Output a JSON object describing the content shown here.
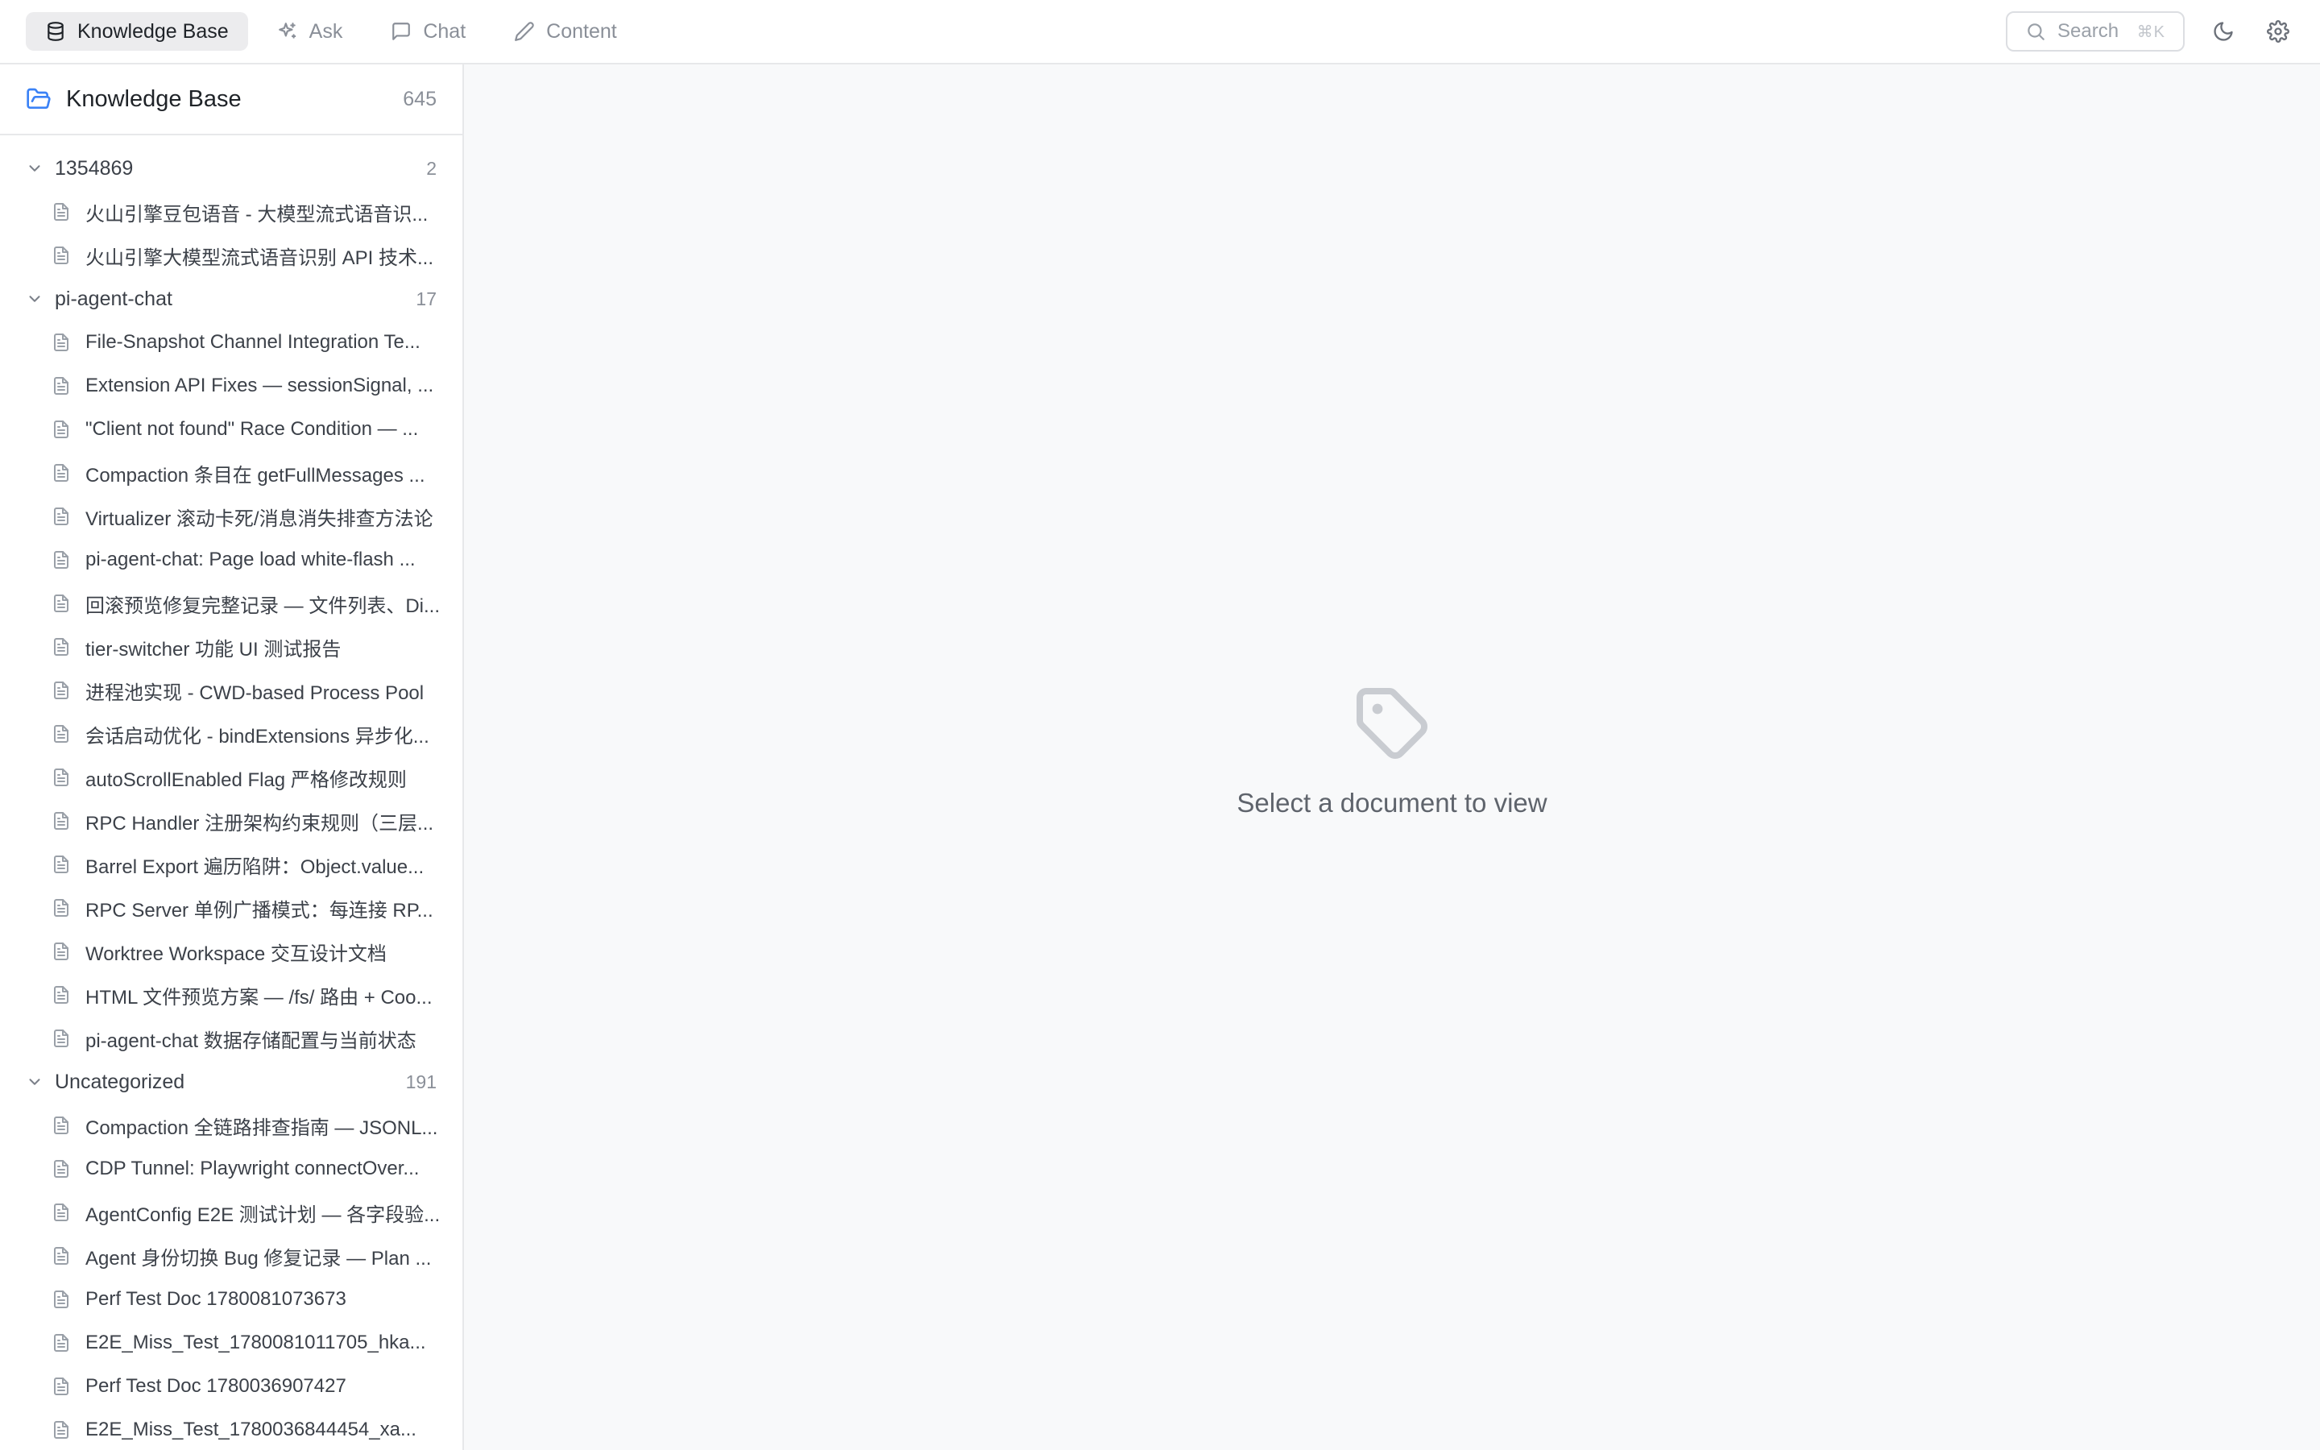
{
  "topbar": {
    "tabs": [
      {
        "label": "Knowledge Base",
        "icon": "database-icon",
        "active": true
      },
      {
        "label": "Ask",
        "icon": "sparkles-icon",
        "active": false
      },
      {
        "label": "Chat",
        "icon": "message-square-icon",
        "active": false
      },
      {
        "label": "Content",
        "icon": "pencil-icon",
        "active": false
      }
    ],
    "search": {
      "label": "Search",
      "shortcut": "⌘K"
    },
    "theme_toggle_icon": "moon-icon",
    "settings_icon": "gear-icon"
  },
  "sidebar": {
    "title": "Knowledge Base",
    "count": "645",
    "groups": [
      {
        "name": "1354869",
        "count": "2",
        "docs": [
          "火山引擎豆包语音 - 大模型流式语音识...",
          "火山引擎大模型流式语音识别 API 技术..."
        ]
      },
      {
        "name": "pi-agent-chat",
        "count": "17",
        "docs": [
          "File-Snapshot Channel Integration Te...",
          "Extension API Fixes — sessionSignal, ...",
          "\"Client not found\" Race Condition — ...",
          "Compaction 条目在 getFullMessages ...",
          "Virtualizer 滚动卡死/消息消失排查方法论",
          "pi-agent-chat: Page load white-flash ...",
          "回滚预览修复完整记录 — 文件列表、Di...",
          "tier-switcher 功能 UI 测试报告",
          "进程池实现 - CWD-based Process Pool",
          "会话启动优化 - bindExtensions 异步化...",
          "autoScrollEnabled Flag 严格修改规则",
          "RPC Handler 注册架构约束规则（三层...",
          "Barrel Export 遍历陷阱：Object.value...",
          "RPC Server 单例广播模式：每连接 RP...",
          "Worktree Workspace 交互设计文档",
          "HTML 文件预览方案 — /fs/ 路由 + Coo...",
          "pi-agent-chat 数据存储配置与当前状态"
        ]
      },
      {
        "name": "Uncategorized",
        "count": "191",
        "docs": [
          "Compaction 全链路排查指南 — JSONL...",
          "CDP Tunnel: Playwright connectOver...",
          "AgentConfig E2E 测试计划 — 各字段验...",
          "Agent 身份切换 Bug 修复记录 — Plan ...",
          "Perf Test Doc 1780081073673",
          "E2E_Miss_Test_1780081011705_hka...",
          "Perf Test Doc 1780036907427",
          "E2E_Miss_Test_1780036844454_xa..."
        ]
      }
    ]
  },
  "main": {
    "empty_icon": "tag-icon",
    "empty_text": "Select a document to view"
  }
}
